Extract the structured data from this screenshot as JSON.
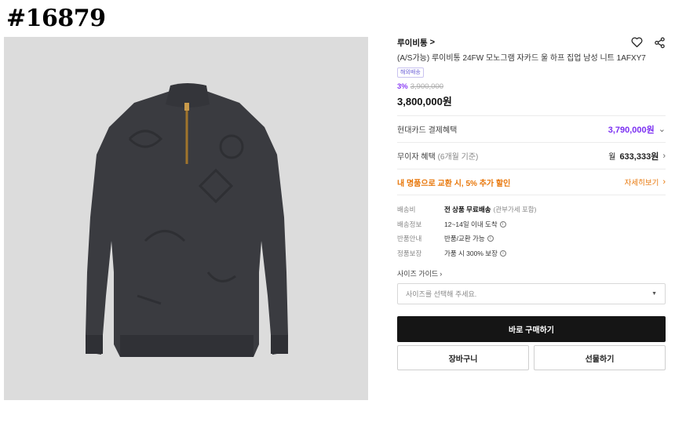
{
  "product_id": "#16879",
  "brand": {
    "name": "루이비통",
    "chevron": ">"
  },
  "product_name": "(A/S가능) 루이비통 24FW 모노그램 자카드 울 하프 집업 남성 니트 1AFXY7",
  "badge": "해외배송",
  "price": {
    "discount_rate": "3%",
    "original": "3,900,000",
    "sale": "3,800,000원"
  },
  "card_benefit": {
    "label": "현대카드 결제혜택",
    "value": "3,790,000원"
  },
  "interest_free": {
    "label": "무이자 혜택",
    "label_sub": "(6개월 기준)",
    "prefix": "월",
    "value": "633,333원"
  },
  "promo": {
    "label": "내 명품으로 교환 시, 5% 추가 할인",
    "link": "자세히보기"
  },
  "details": [
    {
      "label": "배송비",
      "value": "전 상품 무료배송",
      "extra": "(관부가세 포함)"
    },
    {
      "label": "배송정보",
      "value": "12~14일 이내 도착",
      "extra": ""
    },
    {
      "label": "반품안내",
      "value": "반품/교환 가능",
      "extra": ""
    },
    {
      "label": "정품보장",
      "value": "가품 시 300% 보장",
      "extra": ""
    }
  ],
  "size_guide": "사이즈 가이드",
  "size_select": {
    "placeholder": "사이즈를 선택해 주세요."
  },
  "buttons": {
    "buy": "바로 구매하기",
    "cart": "장바구니",
    "gift": "선물하기"
  },
  "icons": {
    "wishlist": "heart-icon",
    "share": "share-icon",
    "info": "info-icon"
  },
  "colors": {
    "accent": "#7b2ff2",
    "promo": "#e8770a",
    "buy_button": "#151515",
    "image_bg": "#dcdcdc"
  }
}
